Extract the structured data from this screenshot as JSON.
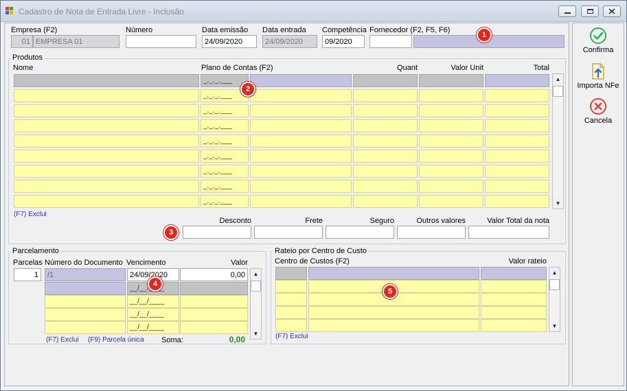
{
  "window": {
    "title": "Cadastro de Nota de Entrada Livre - Inclusão"
  },
  "header": {
    "empresa_label": "Empresa (F2)",
    "empresa_code": "01",
    "empresa_name": "EMPRESA 01",
    "numero_label": "Número",
    "numero_value": "",
    "data_emissao_label": "Data emissão",
    "data_emissao_value": "24/09/2020",
    "data_entrada_label": "Data entrada",
    "data_entrada_value": "24/09/2020",
    "competencia_label": "Competência",
    "competencia_value": "09/2020",
    "fornecedor_label": "Fornecedor (F2, F5, F6)"
  },
  "produtos": {
    "title": "Produtos",
    "columns": {
      "nome": "Nome",
      "plano": "Plano de Contas (F2)",
      "quant": "Quant",
      "valor_unit": "Valor Unit",
      "total": "Total"
    },
    "mask": "_._._.___",
    "row_count": 9,
    "exclui": "(F7) Exclui",
    "totals": {
      "desconto": "Desconto",
      "frete": "Frete",
      "seguro": "Seguro",
      "outros": "Outros valores",
      "valor_total": "Valor Total da nota"
    }
  },
  "parcelamento": {
    "title": "Parcelamento",
    "columns": {
      "parcelas": "Parcelas",
      "numero_documento": "Número do Documento",
      "vencimento": "Vencimento",
      "valor": "Valor"
    },
    "parcelas_value": "1",
    "first_row": {
      "documento": "/1",
      "vencimento": "24/09/2020",
      "valor": "0,00"
    },
    "date_mask": "__/__/____",
    "footer": {
      "exclui": "(F7) Exclui",
      "parcela_unica": "(F9) Parcela única",
      "soma_label": "Soma:",
      "soma_value": "0,00"
    }
  },
  "rateio": {
    "title": "Rateio por Centro de Custo",
    "columns": {
      "centro": "Centro de Custos (F2)",
      "valor": "Valor rateio"
    },
    "exclui": "(F7) Exclui"
  },
  "sidebar": {
    "confirma": "Confirma",
    "importa": "Importa NFe",
    "cancela": "Cancela"
  },
  "badges": [
    "1",
    "2",
    "3",
    "4",
    "5"
  ],
  "colors": {
    "field_yellow": "#ffffaa",
    "field_lavender": "#c4c4e2",
    "badge_red": "#e0291e",
    "soma_green": "#1f8a1f",
    "confirm_green": "#2fae5a",
    "cancel_red": "#d9453b"
  }
}
